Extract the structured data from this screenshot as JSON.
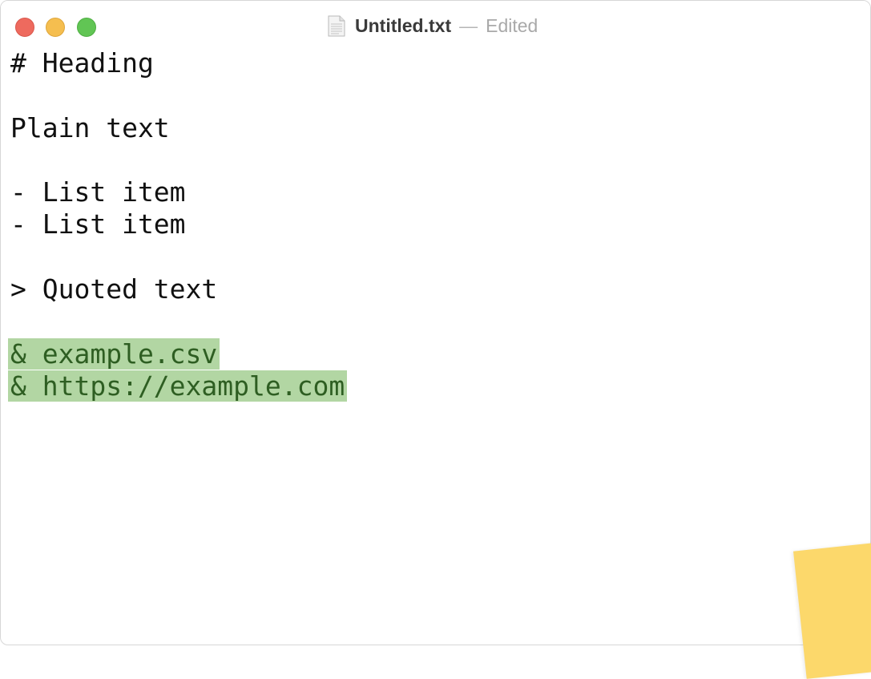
{
  "window": {
    "title": "Untitled.txt",
    "separator": "—",
    "status": "Edited"
  },
  "icons": {
    "close": "close-button-dot",
    "minimize": "minimize-button-dot",
    "zoom": "zoom-button-dot",
    "document": "text-document-icon"
  },
  "colors": {
    "close": "#ee6a5e",
    "minimize": "#f5be4f",
    "zoom": "#61c554",
    "highlight_bg": "#b2d6a3",
    "highlight_text": "#2e5e22",
    "sticky_note": "#fcd86b"
  },
  "editor": {
    "lines": [
      "# Heading",
      "",
      "Plain text",
      "",
      "- List item",
      "- List item",
      "",
      "> Quoted text",
      "",
      "& example.csv",
      "& https://example.com"
    ]
  }
}
